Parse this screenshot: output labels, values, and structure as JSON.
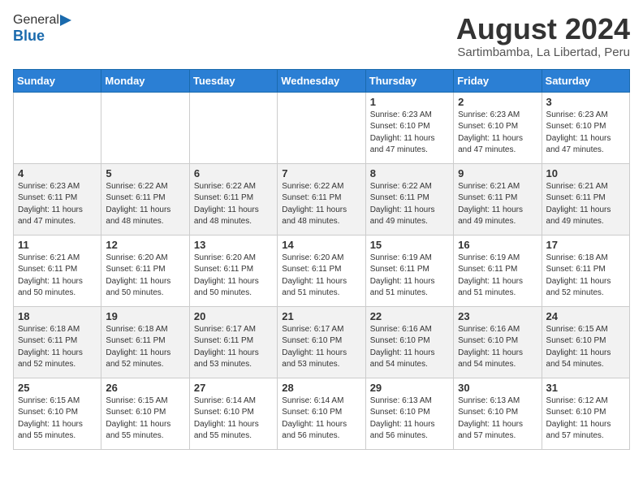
{
  "header": {
    "logo_general": "General",
    "logo_blue": "Blue",
    "month_year": "August 2024",
    "location": "Sartimbamba, La Libertad, Peru"
  },
  "weekdays": [
    "Sunday",
    "Monday",
    "Tuesday",
    "Wednesday",
    "Thursday",
    "Friday",
    "Saturday"
  ],
  "weeks": [
    [
      {
        "day": "",
        "info": ""
      },
      {
        "day": "",
        "info": ""
      },
      {
        "day": "",
        "info": ""
      },
      {
        "day": "",
        "info": ""
      },
      {
        "day": "1",
        "info": "Sunrise: 6:23 AM\nSunset: 6:10 PM\nDaylight: 11 hours\nand 47 minutes."
      },
      {
        "day": "2",
        "info": "Sunrise: 6:23 AM\nSunset: 6:10 PM\nDaylight: 11 hours\nand 47 minutes."
      },
      {
        "day": "3",
        "info": "Sunrise: 6:23 AM\nSunset: 6:10 PM\nDaylight: 11 hours\nand 47 minutes."
      }
    ],
    [
      {
        "day": "4",
        "info": "Sunrise: 6:23 AM\nSunset: 6:11 PM\nDaylight: 11 hours\nand 47 minutes."
      },
      {
        "day": "5",
        "info": "Sunrise: 6:22 AM\nSunset: 6:11 PM\nDaylight: 11 hours\nand 48 minutes."
      },
      {
        "day": "6",
        "info": "Sunrise: 6:22 AM\nSunset: 6:11 PM\nDaylight: 11 hours\nand 48 minutes."
      },
      {
        "day": "7",
        "info": "Sunrise: 6:22 AM\nSunset: 6:11 PM\nDaylight: 11 hours\nand 48 minutes."
      },
      {
        "day": "8",
        "info": "Sunrise: 6:22 AM\nSunset: 6:11 PM\nDaylight: 11 hours\nand 49 minutes."
      },
      {
        "day": "9",
        "info": "Sunrise: 6:21 AM\nSunset: 6:11 PM\nDaylight: 11 hours\nand 49 minutes."
      },
      {
        "day": "10",
        "info": "Sunrise: 6:21 AM\nSunset: 6:11 PM\nDaylight: 11 hours\nand 49 minutes."
      }
    ],
    [
      {
        "day": "11",
        "info": "Sunrise: 6:21 AM\nSunset: 6:11 PM\nDaylight: 11 hours\nand 50 minutes."
      },
      {
        "day": "12",
        "info": "Sunrise: 6:20 AM\nSunset: 6:11 PM\nDaylight: 11 hours\nand 50 minutes."
      },
      {
        "day": "13",
        "info": "Sunrise: 6:20 AM\nSunset: 6:11 PM\nDaylight: 11 hours\nand 50 minutes."
      },
      {
        "day": "14",
        "info": "Sunrise: 6:20 AM\nSunset: 6:11 PM\nDaylight: 11 hours\nand 51 minutes."
      },
      {
        "day": "15",
        "info": "Sunrise: 6:19 AM\nSunset: 6:11 PM\nDaylight: 11 hours\nand 51 minutes."
      },
      {
        "day": "16",
        "info": "Sunrise: 6:19 AM\nSunset: 6:11 PM\nDaylight: 11 hours\nand 51 minutes."
      },
      {
        "day": "17",
        "info": "Sunrise: 6:18 AM\nSunset: 6:11 PM\nDaylight: 11 hours\nand 52 minutes."
      }
    ],
    [
      {
        "day": "18",
        "info": "Sunrise: 6:18 AM\nSunset: 6:11 PM\nDaylight: 11 hours\nand 52 minutes."
      },
      {
        "day": "19",
        "info": "Sunrise: 6:18 AM\nSunset: 6:11 PM\nDaylight: 11 hours\nand 52 minutes."
      },
      {
        "day": "20",
        "info": "Sunrise: 6:17 AM\nSunset: 6:11 PM\nDaylight: 11 hours\nand 53 minutes."
      },
      {
        "day": "21",
        "info": "Sunrise: 6:17 AM\nSunset: 6:10 PM\nDaylight: 11 hours\nand 53 minutes."
      },
      {
        "day": "22",
        "info": "Sunrise: 6:16 AM\nSunset: 6:10 PM\nDaylight: 11 hours\nand 54 minutes."
      },
      {
        "day": "23",
        "info": "Sunrise: 6:16 AM\nSunset: 6:10 PM\nDaylight: 11 hours\nand 54 minutes."
      },
      {
        "day": "24",
        "info": "Sunrise: 6:15 AM\nSunset: 6:10 PM\nDaylight: 11 hours\nand 54 minutes."
      }
    ],
    [
      {
        "day": "25",
        "info": "Sunrise: 6:15 AM\nSunset: 6:10 PM\nDaylight: 11 hours\nand 55 minutes."
      },
      {
        "day": "26",
        "info": "Sunrise: 6:15 AM\nSunset: 6:10 PM\nDaylight: 11 hours\nand 55 minutes."
      },
      {
        "day": "27",
        "info": "Sunrise: 6:14 AM\nSunset: 6:10 PM\nDaylight: 11 hours\nand 55 minutes."
      },
      {
        "day": "28",
        "info": "Sunrise: 6:14 AM\nSunset: 6:10 PM\nDaylight: 11 hours\nand 56 minutes."
      },
      {
        "day": "29",
        "info": "Sunrise: 6:13 AM\nSunset: 6:10 PM\nDaylight: 11 hours\nand 56 minutes."
      },
      {
        "day": "30",
        "info": "Sunrise: 6:13 AM\nSunset: 6:10 PM\nDaylight: 11 hours\nand 57 minutes."
      },
      {
        "day": "31",
        "info": "Sunrise: 6:12 AM\nSunset: 6:10 PM\nDaylight: 11 hours\nand 57 minutes."
      }
    ]
  ]
}
